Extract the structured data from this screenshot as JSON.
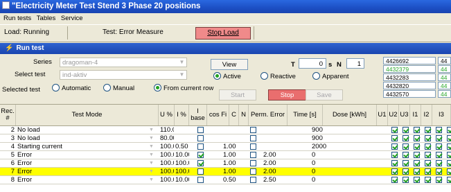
{
  "window": {
    "title": "\"Electricity Meter Test Stend 3 Phase 20 positions"
  },
  "menu": [
    "Run tests",
    "Tables",
    "Service"
  ],
  "status": {
    "load": "Load: Running",
    "test": "Test: Error Measure",
    "stop_load": "Stop Load"
  },
  "panel": {
    "title": "Run test"
  },
  "form": {
    "series_label": "Series",
    "series_value": "dragoman-4",
    "select_test_label": "Select test",
    "select_test_value": "ind-aktiv",
    "selected_test_label": "Selected test",
    "view_label": "View",
    "t_label": "T",
    "t_value": "0",
    "s_label": "s",
    "n_label": "N",
    "n_value": "1",
    "mode_options": [
      "Automatic",
      "Manual",
      "From current row"
    ],
    "mode_selected": "From current row",
    "energy_options": [
      "Active",
      "Reactive",
      "Apparent"
    ],
    "energy_selected": "Active",
    "start_label": "Start",
    "stop_label": "Stop",
    "save_label": "Save"
  },
  "meters": [
    {
      "value": "4426692",
      "color": "#000000"
    },
    {
      "value": "4432379",
      "color": "#2aa72a"
    },
    {
      "value": "4432283",
      "color": "#000000"
    },
    {
      "value": "4432820",
      "color": "#000000"
    },
    {
      "value": "4432570",
      "color": "#000000"
    }
  ],
  "meters_col2": [
    {
      "value": "44",
      "color": "#000000"
    },
    {
      "value": "44",
      "color": "#2aa72a"
    },
    {
      "value": "44",
      "color": "#2aa72a"
    },
    {
      "value": "44",
      "color": "#2aa72a"
    },
    {
      "value": "44",
      "color": "#2aa72a"
    }
  ],
  "table": {
    "headers": [
      "Rec. #",
      "Test Mode",
      "U %",
      "I %",
      "I base",
      "cos Fi",
      "C",
      "N",
      "Perm. Error",
      "Time [s]",
      "Dose [kWh]",
      "U1",
      "U2",
      "U3",
      "I1",
      "I2",
      "I3"
    ],
    "rows": [
      {
        "rec": "2",
        "mode": "No load",
        "u": "110.00",
        "i": "",
        "ibase": false,
        "cos": "",
        "c": false,
        "perm": "",
        "time": "900",
        "checks": [
          true,
          true,
          true,
          true,
          true,
          true
        ],
        "selected": false
      },
      {
        "rec": "3",
        "mode": "No load",
        "u": "80.00",
        "i": "",
        "ibase": false,
        "cos": "",
        "c": false,
        "perm": "",
        "time": "900",
        "checks": [
          true,
          true,
          true,
          true,
          true,
          true
        ],
        "selected": false
      },
      {
        "rec": "4",
        "mode": "Starting current",
        "u": "100.00",
        "i": "0.50",
        "ibase": false,
        "cos": "1.00",
        "c": false,
        "perm": "",
        "time": "2000",
        "checks": [
          true,
          true,
          true,
          true,
          true,
          true
        ],
        "selected": false
      },
      {
        "rec": "5",
        "mode": "Error",
        "u": "100.00",
        "i": "10.00",
        "ibase": true,
        "cos": "1.00",
        "c": false,
        "perm": "2.00",
        "time": "0",
        "checks": [
          true,
          true,
          true,
          true,
          true,
          true
        ],
        "selected": false
      },
      {
        "rec": "6",
        "mode": "Error",
        "u": "100.00",
        "i": "100.00",
        "ibase": true,
        "cos": "1.00",
        "c": false,
        "perm": "2.00",
        "time": "0",
        "checks": [
          true,
          true,
          true,
          true,
          true,
          true
        ],
        "selected": false
      },
      {
        "rec": "7",
        "mode": "Error",
        "u": "100.00",
        "i": "100.00",
        "ibase": false,
        "cos": "1.00",
        "c": false,
        "perm": "2.00",
        "time": "0",
        "checks": [
          true,
          true,
          true,
          true,
          true,
          true
        ],
        "selected": true
      },
      {
        "rec": "8",
        "mode": "Error",
        "u": "100.00",
        "i": "10.00",
        "ibase": false,
        "cos": "0.50",
        "c": false,
        "perm": "2.50",
        "time": "0",
        "checks": [
          true,
          true,
          true,
          true,
          true,
          true
        ],
        "selected": false
      }
    ]
  }
}
